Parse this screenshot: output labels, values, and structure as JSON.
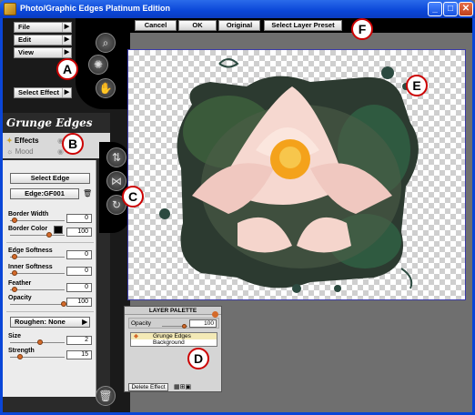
{
  "window": {
    "title": "Photo/Graphic Edges Platinum Edition",
    "min": "_",
    "max": "□",
    "close": "✕"
  },
  "menus": [
    {
      "label": "File"
    },
    {
      "label": "Edit"
    },
    {
      "label": "View"
    },
    {
      "label": "Select Effect"
    }
  ],
  "toolbar": {
    "cancel": "Cancel",
    "ok": "OK",
    "original": "Original",
    "select_preset": "Select Layer Preset"
  },
  "callouts": {
    "a": "A",
    "b": "B",
    "c": "C",
    "d": "D",
    "e": "E",
    "f": "F"
  },
  "panel": {
    "title": "Grunge Edges",
    "tabs": {
      "effects": "Effects",
      "mood": "Mood"
    },
    "select_edge": "Select Edge",
    "edge_name": "Edge:GF001",
    "border_width": {
      "label": "Border Width",
      "value": "0"
    },
    "border_color": {
      "label": "Border Color",
      "value": "100"
    },
    "edge_softness": {
      "label": "Edge Softness",
      "value": "0"
    },
    "inner_softness": {
      "label": "Inner Softness",
      "value": "0"
    },
    "feather": {
      "label": "Feather",
      "value": "0"
    },
    "opacity": {
      "label": "Opacity",
      "value": "100"
    },
    "roughen": "Roughen: None",
    "size": {
      "label": "Size",
      "value": "2"
    },
    "strength": {
      "label": "Strength",
      "value": "15"
    }
  },
  "palette": {
    "title": "LAYER PALETTE",
    "opacity_label": "Opacity",
    "opacity_value": "100",
    "layers": [
      "Grunge Edges",
      "Background"
    ],
    "delete": "Delete Effect"
  },
  "colors": {
    "accent": "#0a46d8",
    "callout_border": "#cc0000",
    "slider_knob": "#d46a2a"
  }
}
